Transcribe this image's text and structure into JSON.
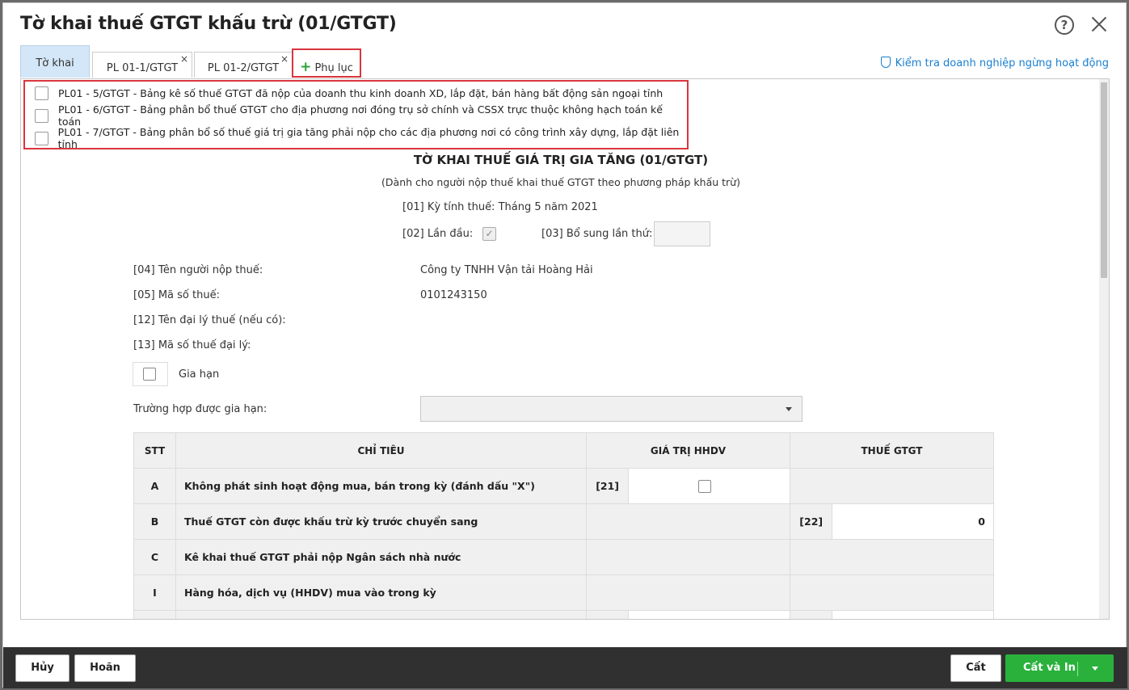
{
  "dialog": {
    "title": "Tờ khai thuế GTGT khấu trừ (01/GTGT)",
    "help_glyph": "?"
  },
  "tabs": [
    {
      "label": "Tờ khai"
    },
    {
      "label": "PL 01-1/GTGT"
    },
    {
      "label": "PL 01-2/GTGT"
    }
  ],
  "tab_close_glyph": "×",
  "add_tab": {
    "plus": "+",
    "label": "Phụ lục"
  },
  "check_link": "Kiểm tra doanh nghiệp ngừng hoạt động",
  "appendix_dropdown": [
    {
      "label": "PL01 - 5/GTGT - Bảng kê số thuế GTGT đã nộp của doanh thu kinh doanh XD, lắp đặt, bán hàng bất động sản ngoại tỉnh"
    },
    {
      "label": "PL01 - 6/GTGT - Bảng phân bổ thuế GTGT cho địa phương nơi đóng trụ sở chính và CSSX trực thuộc không hạch toán kế toán"
    },
    {
      "label": "PL01 - 7/GTGT - Bảng phân bổ số thuế giá trị gia tăng phải nộp cho các địa phương nơi có công trình xây dựng, lắp đặt liên tỉnh"
    }
  ],
  "form": {
    "title": "TỜ KHAI THUẾ GIÁ TRỊ GIA TĂNG (01/GTGT)",
    "subtitle": "(Dành cho người nộp thuế khai thuế GTGT theo phương pháp khấu trừ)",
    "period": "[01] Kỳ tính thuế: Tháng 5 năm 2021",
    "first_time_label": "[02] Lần đầu:",
    "check_glyph": "✓",
    "supplement_label": "[03] Bổ sung lần thứ:",
    "taxpayer_name_label": "[04] Tên người nộp thuế:",
    "taxpayer_name": "Công ty TNHH Vận tải Hoàng Hải",
    "tax_code_label": "[05] Mã số thuế:",
    "tax_code": "0101243150",
    "agent_name_label": "[12] Tên đại lý thuế (nếu có):",
    "agent_code_label": "[13] Mã số thuế đại lý:",
    "extension_label": "Gia hạn",
    "extension_case_label": "Trường hợp được gia hạn:"
  },
  "table": {
    "headers": {
      "stt": "STT",
      "item": "CHỈ TIÊU",
      "value": "GIÁ TRỊ HHDV",
      "tax": "THUẾ GTGT"
    },
    "rows": [
      {
        "stt": "A",
        "item": "Không phát sinh hoạt động mua, bán trong kỳ (đánh dấu \"X\")",
        "code": "[21]"
      },
      {
        "stt": "B",
        "item": "Thuế GTGT còn được khấu trừ kỳ trước chuyển sang",
        "code": "[22]",
        "value": "0"
      },
      {
        "stt": "C",
        "item": "Kê khai thuế GTGT phải nộp Ngân sách nhà nước"
      },
      {
        "stt": "I",
        "item": "Hàng hóa, dịch vụ (HHDV) mua vào trong kỳ"
      }
    ]
  },
  "footer": {
    "cancel": "Hủy",
    "defer": "Hoãn",
    "save": "Cất",
    "save_print": "Cất và In"
  }
}
